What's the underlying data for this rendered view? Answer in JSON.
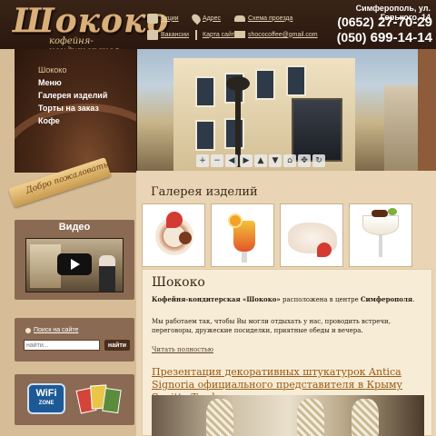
{
  "brand": {
    "name": "Шококо",
    "tagline": "кофейня-кондитерская"
  },
  "header": {
    "links": [
      {
        "label": "Акции",
        "icon": "chat-icon"
      },
      {
        "label": "Адрес",
        "icon": "map-pin-icon"
      },
      {
        "label": "Схема проезда",
        "icon": "car-icon"
      },
      {
        "label": "Вакансии",
        "icon": "briefcase-icon"
      },
      {
        "label": "Карта сайта",
        "icon": "signpost-icon"
      },
      {
        "label": "shococoffee@gmail.com",
        "icon": "mail-icon"
      }
    ],
    "address": "Симферополь, ул. Горького, 14",
    "phones": [
      {
        "code": "(0652)",
        "number": "27-70-29"
      },
      {
        "code": "(050)",
        "number": "699-14-14"
      }
    ]
  },
  "menu": {
    "items": [
      {
        "label": "Шококо",
        "active": true
      },
      {
        "label": "Меню",
        "active": false
      },
      {
        "label": "Галерея изделий",
        "active": false
      },
      {
        "label": "Торты на заказ",
        "active": false
      },
      {
        "label": "Кофе",
        "active": false
      }
    ],
    "ribbon": "Добро пожаловать!"
  },
  "video": {
    "title": "Видео"
  },
  "search": {
    "label": "Поиск на сайте",
    "placeholder": "найти...",
    "button": "найти"
  },
  "promo": {
    "wifi_top": "WiFi",
    "wifi_bottom": "ZONE"
  },
  "slider": {
    "controls": [
      "+",
      "−",
      "◀",
      "▶",
      "▲",
      "▼",
      "⌂",
      "✥",
      "↻"
    ]
  },
  "gallery": {
    "title": "Галерея изделий",
    "thumbs": [
      "dessert-plate",
      "fruit-cocktail",
      "meringue-cake",
      "cream-glass"
    ]
  },
  "content": {
    "title": "Шококо",
    "intro_bold1": "Кофейня-кондитерская «Шококо»",
    "intro_mid": " расположена в центре ",
    "intro_bold2": "Симферополя",
    "intro_end": ".",
    "body": "Мы работаем так, чтобы Вы могли отдыхать у нас, проводить встречи, переговоры, дружеские посиделки, приятные обеды и вечера.",
    "read_more": "Читать полностью",
    "news_title": "Презентация декоративных штукатурок Antica Signoria официального представителя в Крыму Sagitta Trade"
  },
  "colors": {
    "header_bg": "#2a170e",
    "accent_link": "#9a5a12",
    "panel_bg": "#8a6a52",
    "page_bg": "#e9d5b5"
  }
}
